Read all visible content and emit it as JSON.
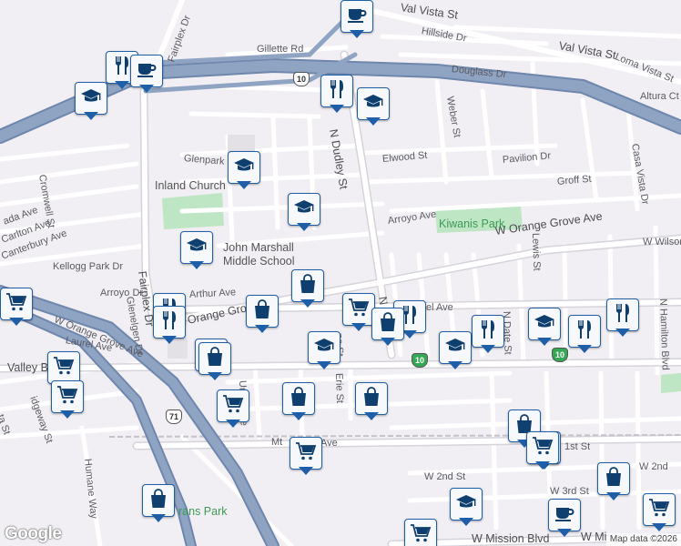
{
  "map": {
    "footer": "Map data ©2026",
    "logo": "Google",
    "colors": {
      "freeway": "#8fa4c3",
      "freeway_edge": "#6f86ad",
      "road": "#ffffff",
      "road_edge": "#d6d3da",
      "park": "#bfe6c4",
      "land": "#f1eff3",
      "marker_border": "#1e5fa8",
      "marker_icon": "#0e3f6e"
    }
  },
  "labels": {
    "fairplex_dr_top": "Fairplex Dr",
    "fairplex_dr": "Fairplex Dr",
    "gillette_rd": "Gillette Rd",
    "val_vista_st_top": "Val Vista St",
    "val_vista_st": "Val Vista St",
    "hillside_dr": "Hillside Dr",
    "loma_vista_st": "Loma Vista St",
    "douglass_dr": "Douglass Dr",
    "altura_ct": "Altura Ct",
    "weber_st": "Weber St",
    "n_dudley_st": "N Dudley St",
    "glenpark_st": "Glenpark St",
    "elwood_st": "Elwood St",
    "pavilion_dr": "Pavilion Dr",
    "groff_st": "Groff St",
    "casa_vista_dr": "Casa Vista Dr",
    "cromwell_st": "Cromwell St",
    "inland_church": "Inland Church",
    "arroyo_ave": "Arroyo Ave",
    "kiwanis_park": "Kiwanis Park",
    "w_orange_grove_ave_east": "W Orange Grove Ave",
    "w_wilson": "W Wilson",
    "john_marshall_1": "John Marshall",
    "john_marshall_2": "Middle School",
    "canterbury_ave": "Canterbury Ave",
    "carlton_ave": "Carlton Ave",
    "ada_ave": "ada Ave",
    "kellogg_park_dr": "Kellogg Park Dr",
    "arroyo_dr": "Arroyo Dr",
    "arthur_ave": "Arthur Ave",
    "w_orange_grove_ave_west": "W Orange Grove Ave",
    "orange_grov": "Orange Grov",
    "laurel_ave_west": "Laurel Ave",
    "laurel_ave_east": "el Ave",
    "glenelgen_dr": "Glenelgen Dr",
    "n_date_st": "N Date St",
    "lewis_st": "Lewis St",
    "n_hamilton_blvd": "N Hamilton Blvd",
    "valley_b": "Valley B",
    "ridgeway_st": "idgeway St",
    "ta_st": "ta St",
    "union_ave": "Union Ave",
    "erie_st": "Erie St",
    "ne_st": "ne St",
    "n_d": "N D",
    "mt_ave": "Mt",
    "mt_ave_2": "Ave",
    "w_1st_st": "1st St",
    "w_2nd_st": "W 2nd St",
    "w_2nd_st_east": "W 2nd",
    "w_3rd_st": "W 3rd St",
    "humane_way": "Humane Way",
    "trans_park": "rans Park",
    "w_mission_blvd": "W Mission Blvd",
    "w_mi": "W Mi",
    "route_71": "71",
    "route_10_a": "10",
    "route_10_b": "10",
    "route_10_c": "10"
  },
  "markers": [
    {
      "type": "coffee",
      "icon": "coffee-icon"
    },
    {
      "type": "restaurant",
      "icon": "fork-knife-icon"
    },
    {
      "type": "coffee",
      "icon": "coffee-icon"
    },
    {
      "type": "school",
      "icon": "graduation-cap-icon"
    },
    {
      "type": "restaurant",
      "icon": "fork-knife-icon"
    },
    {
      "type": "school",
      "icon": "graduation-cap-icon"
    },
    {
      "type": "school",
      "icon": "graduation-cap-icon"
    },
    {
      "type": "school",
      "icon": "graduation-cap-icon"
    },
    {
      "type": "school",
      "icon": "graduation-cap-icon"
    },
    {
      "type": "shopping",
      "icon": "shopping-bag-icon"
    },
    {
      "type": "grocery",
      "icon": "shopping-cart-icon"
    },
    {
      "type": "restaurant",
      "icon": "fork-knife-icon"
    },
    {
      "type": "restaurant",
      "icon": "fork-knife-icon"
    },
    {
      "type": "shopping",
      "icon": "shopping-bag-icon"
    },
    {
      "type": "grocery",
      "icon": "shopping-cart-icon"
    },
    {
      "type": "restaurant",
      "icon": "fork-knife-icon"
    },
    {
      "type": "shopping",
      "icon": "shopping-bag-icon"
    },
    {
      "type": "restaurant",
      "icon": "fork-knife-icon"
    },
    {
      "type": "school",
      "icon": "graduation-cap-icon"
    },
    {
      "type": "restaurant",
      "icon": "fork-knife-icon"
    },
    {
      "type": "restaurant",
      "icon": "fork-knife-icon"
    },
    {
      "type": "school",
      "icon": "graduation-cap-icon"
    },
    {
      "type": "school",
      "icon": "graduation-cap-icon"
    },
    {
      "type": "grocery",
      "icon": "shopping-cart-icon"
    },
    {
      "type": "grocery",
      "icon": "shopping-cart-icon"
    },
    {
      "type": "shopping",
      "icon": "shopping-bag-icon"
    },
    {
      "type": "shopping",
      "icon": "shopping-bag-icon"
    },
    {
      "type": "grocery",
      "icon": "shopping-cart-icon"
    },
    {
      "type": "shopping",
      "icon": "shopping-bag-icon"
    },
    {
      "type": "shopping",
      "icon": "shopping-bag-icon"
    },
    {
      "type": "grocery",
      "icon": "shopping-cart-icon"
    },
    {
      "type": "shopping",
      "icon": "shopping-bag-icon"
    },
    {
      "type": "grocery",
      "icon": "shopping-cart-icon"
    },
    {
      "type": "shopping",
      "icon": "shopping-bag-icon"
    },
    {
      "type": "school",
      "icon": "graduation-cap-icon"
    },
    {
      "type": "coffee",
      "icon": "coffee-icon"
    },
    {
      "type": "grocery",
      "icon": "shopping-cart-icon"
    },
    {
      "type": "grocery",
      "icon": "shopping-cart-icon"
    },
    {
      "type": "shopping",
      "icon": "shopping-bag-icon"
    },
    {
      "type": "grocery",
      "icon": "shopping-cart-icon"
    }
  ]
}
